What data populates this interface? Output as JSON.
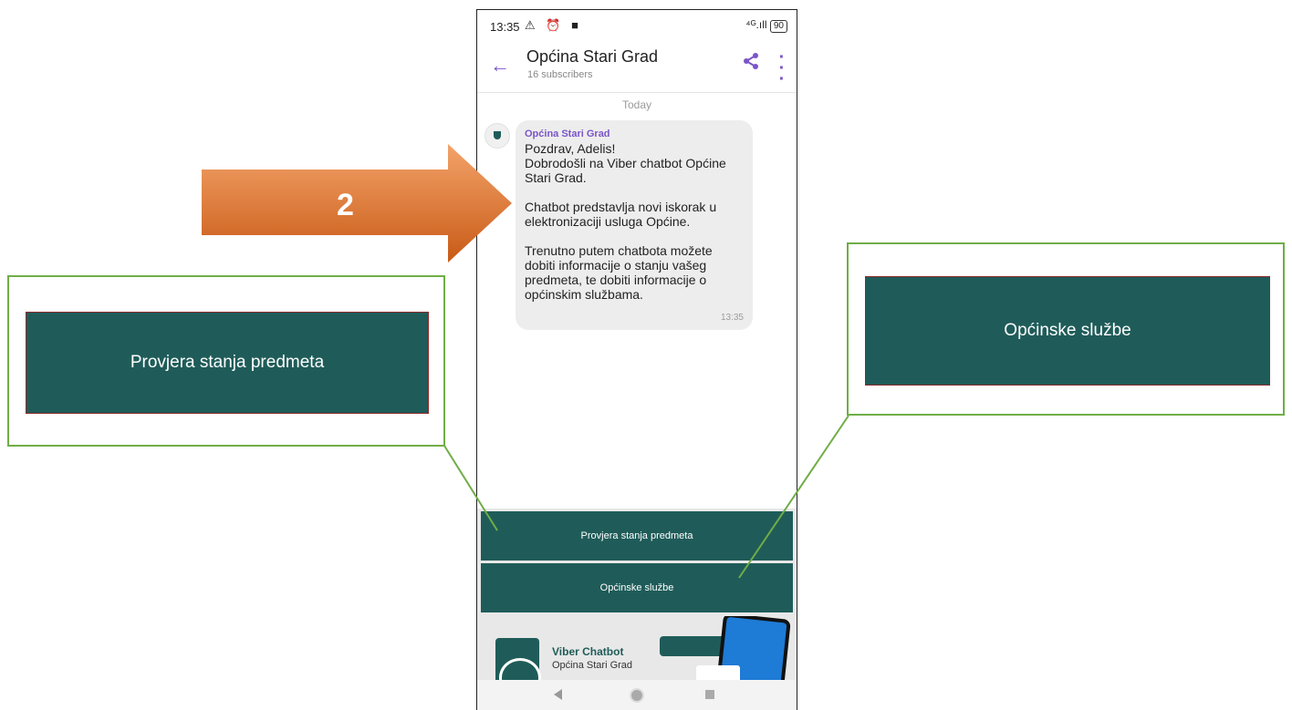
{
  "status_bar": {
    "time": "13:35",
    "icons": "⚠ ⏰ ■",
    "signal": "⁴ᴳ.ıll",
    "battery": "90"
  },
  "header": {
    "title": "Općina Stari Grad",
    "subtitle": "16 subscribers"
  },
  "chat": {
    "date_separator": "Today",
    "message": {
      "sender": "Općina Stari Grad",
      "text": "Pozdrav, Adelis!\nDobrodošli na Viber chatbot Općine Stari Grad.\n\nChatbot predstavlja novi iskorak u elektronizaciji usluga Općine.\n\nTrenutno putem chatbota možete dobiti informacije o stanju vašeg predmeta, te dobiti informacije o općinskim službama.",
      "time": "13:35"
    }
  },
  "keyboard": {
    "button1": "Provjera stanja predmeta",
    "button2": "Općinske službe",
    "banner_title": "Viber Chatbot",
    "banner_subtitle": "Općina Stari Grad"
  },
  "callouts": {
    "arrow_number": "2",
    "left_label": "Provjera stanja predmeta",
    "right_label": "Općinske službe"
  },
  "colors": {
    "accent": "#7b55c9",
    "button": "#1f5c59",
    "callout_border": "#70ad47",
    "arrow": "#e07a2c"
  }
}
